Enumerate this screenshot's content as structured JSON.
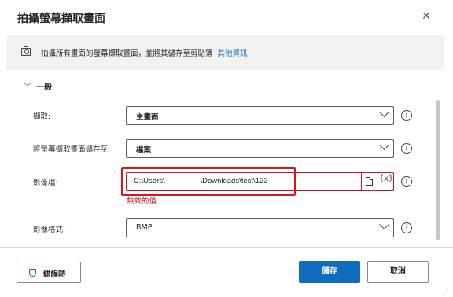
{
  "dialog": {
    "title": "拍攝螢幕擷取畫面",
    "close_glyph": "✕"
  },
  "info": {
    "text": "拍攝所有畫面的螢幕擷取畫面，並將其儲存至剪貼簿",
    "link": "其他資訊",
    "icon": "camera-icon"
  },
  "section": {
    "chevron": "﹀",
    "title": "一般"
  },
  "fields": {
    "capture": {
      "label": "擷取:",
      "value": "主畫面"
    },
    "save_to": {
      "label": "將螢幕擷取畫面儲存至:",
      "value": "檔案"
    },
    "image_file": {
      "label": "影像檔:",
      "value": "C:\\Users\\                 \\Downloads\\test\\123",
      "error": "無效的值",
      "var_glyph": "{x}"
    },
    "image_format": {
      "label": "影像格式:",
      "value": "BMP"
    }
  },
  "help_glyph": "i",
  "footer": {
    "on_error": "錯誤時",
    "save": "儲存",
    "cancel": "取消"
  },
  "colors": {
    "accent": "#0f6cbd",
    "error": "#c50f1f",
    "highlight": "#d11a1a"
  }
}
